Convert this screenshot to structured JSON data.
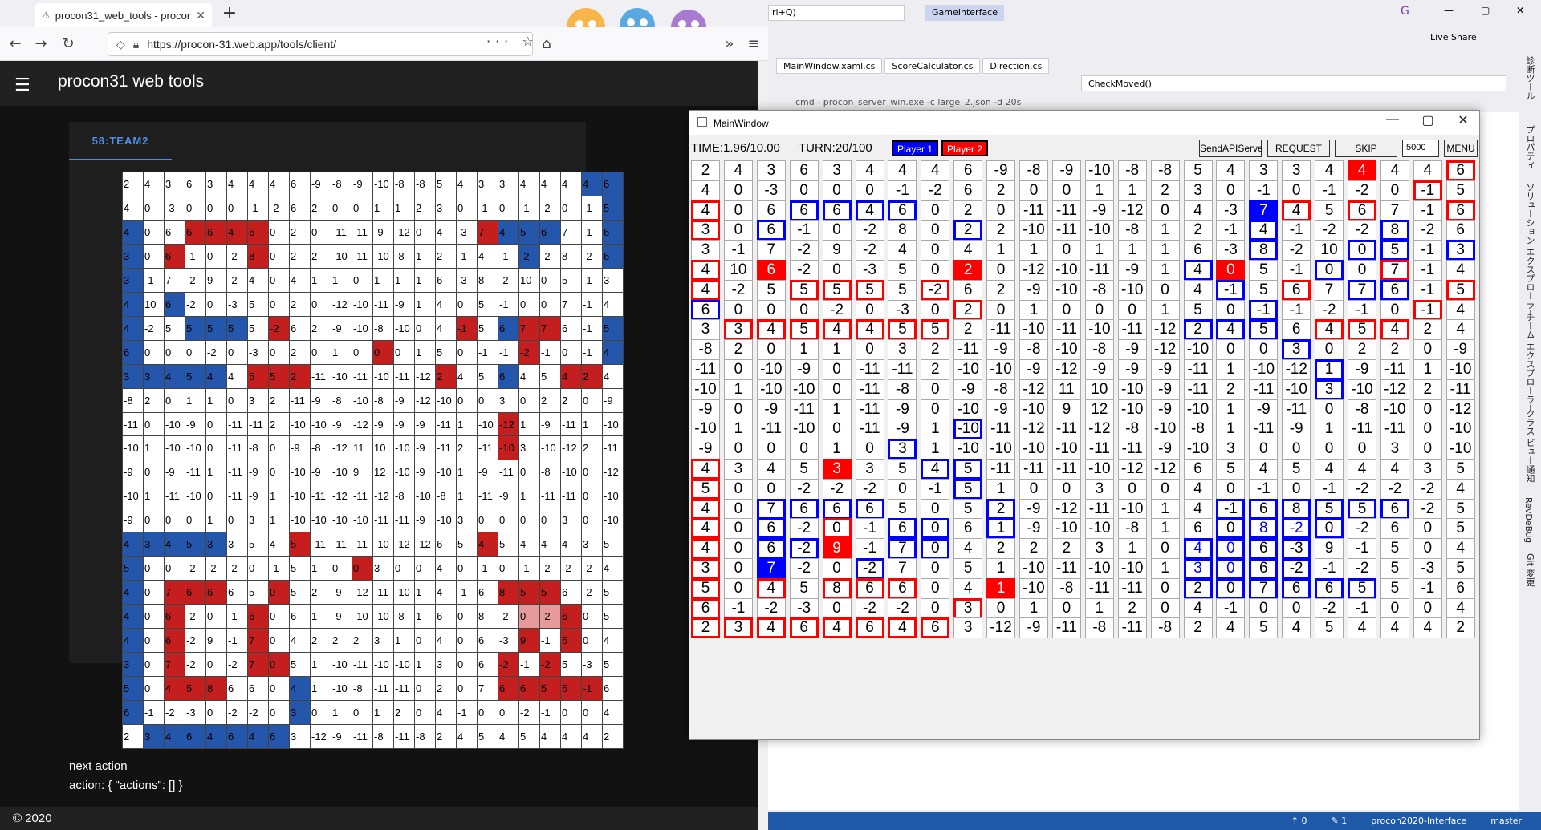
{
  "browser": {
    "tab_title": "procon31_web_tools - procon3",
    "url": "https://procon-31.web.app/tools/client/",
    "app_title": "procon31 web tools",
    "team_tab": "58:TEAM2",
    "next_action_label": "next action",
    "action_text": "action: { \"actions\": [] }",
    "footer": "© 2020"
  },
  "web_grid": [
    [
      "2",
      "4",
      "3",
      "6",
      "3",
      "4",
      "4",
      "4",
      "6",
      "-9",
      "-8",
      "-9",
      "-10",
      "-8",
      "-8",
      "5",
      "4",
      "3",
      "3",
      "4",
      "4",
      "4",
      "4",
      "6"
    ],
    [
      "4",
      "0",
      "-3",
      "0",
      "0",
      "0",
      "-1",
      "-2",
      "6",
      "2",
      "0",
      "0",
      "1",
      "1",
      "2",
      "3",
      "0",
      "-1",
      "0",
      "-1",
      "-2",
      "0",
      "-1",
      "5"
    ],
    [
      "4",
      "0",
      "6",
      "6",
      "6",
      "4",
      "6",
      "0",
      "2",
      "0",
      "-11",
      "-11",
      "-9",
      "-12",
      "0",
      "4",
      "-3",
      "7",
      "4",
      "5",
      "6",
      "7",
      "-1",
      "6"
    ],
    [
      "3",
      "0",
      "6",
      "-1",
      "0",
      "-2",
      "8",
      "0",
      "2",
      "2",
      "-10",
      "-11",
      "-10",
      "-8",
      "1",
      "2",
      "-1",
      "4",
      "-1",
      "-2",
      "-2",
      "8",
      "-2",
      "6"
    ],
    [
      "3",
      "-1",
      "7",
      "-2",
      "9",
      "-2",
      "4",
      "0",
      "4",
      "1",
      "1",
      "0",
      "1",
      "1",
      "1",
      "6",
      "-3",
      "8",
      "-2",
      "10",
      "0",
      "5",
      "-1",
      "3"
    ],
    [
      "4",
      "10",
      "6",
      "-2",
      "0",
      "-3",
      "5",
      "0",
      "2",
      "0",
      "-12",
      "-10",
      "-11",
      "-9",
      "1",
      "4",
      "0",
      "5",
      "-1",
      "0",
      "0",
      "7",
      "-1",
      "4"
    ],
    [
      "4",
      "-2",
      "5",
      "5",
      "5",
      "5",
      "5",
      "-2",
      "6",
      "2",
      "-9",
      "-10",
      "-8",
      "-10",
      "0",
      "4",
      "-1",
      "5",
      "6",
      "7",
      "7",
      "6",
      "-1",
      "5"
    ],
    [
      "6",
      "0",
      "0",
      "0",
      "-2",
      "0",
      "-3",
      "0",
      "2",
      "0",
      "1",
      "0",
      "0",
      "0",
      "1",
      "5",
      "0",
      "-1",
      "-1",
      "-2",
      "-1",
      "0",
      "-1",
      "4"
    ],
    [
      "3",
      "3",
      "4",
      "5",
      "4",
      "4",
      "5",
      "5",
      "2",
      "-11",
      "-10",
      "-11",
      "-10",
      "-11",
      "-12",
      "2",
      "4",
      "5",
      "6",
      "4",
      "5",
      "4",
      "2",
      "4"
    ],
    [
      "-8",
      "2",
      "0",
      "1",
      "1",
      "0",
      "3",
      "2",
      "-11",
      "-9",
      "-8",
      "-10",
      "-8",
      "-9",
      "-12",
      "-10",
      "0",
      "0",
      "3",
      "0",
      "2",
      "2",
      "0",
      "-9"
    ],
    [
      "-11",
      "0",
      "-10",
      "-9",
      "0",
      "-11",
      "-11",
      "2",
      "-10",
      "-10",
      "-9",
      "-12",
      "-9",
      "-9",
      "-9",
      "-11",
      "1",
      "-10",
      "-12",
      "1",
      "-9",
      "-11",
      "1",
      "-10"
    ],
    [
      "-10",
      "1",
      "-10",
      "-10",
      "0",
      "-11",
      "-8",
      "0",
      "-9",
      "-8",
      "-12",
      "11",
      "10",
      "-10",
      "-9",
      "-11",
      "2",
      "-11",
      "-10",
      "3",
      "-10",
      "-12",
      "2",
      "-11"
    ],
    [
      "-9",
      "0",
      "-9",
      "-11",
      "1",
      "-11",
      "-9",
      "0",
      "-10",
      "-9",
      "-10",
      "9",
      "12",
      "-10",
      "-9",
      "-10",
      "1",
      "-9",
      "-11",
      "0",
      "-8",
      "-10",
      "0",
      "-12"
    ],
    [
      "-10",
      "1",
      "-11",
      "-10",
      "0",
      "-11",
      "-9",
      "1",
      "-10",
      "-11",
      "-12",
      "-11",
      "-12",
      "-8",
      "-10",
      "-8",
      "1",
      "-11",
      "-9",
      "1",
      "-11",
      "-11",
      "0",
      "-10"
    ],
    [
      "-9",
      "0",
      "0",
      "0",
      "1",
      "0",
      "3",
      "1",
      "-10",
      "-10",
      "-10",
      "-10",
      "-11",
      "-11",
      "-9",
      "-10",
      "3",
      "0",
      "0",
      "0",
      "0",
      "3",
      "0",
      "-10"
    ],
    [
      "4",
      "3",
      "4",
      "5",
      "3",
      "3",
      "5",
      "4",
      "5",
      "-11",
      "-11",
      "-11",
      "-10",
      "-12",
      "-12",
      "6",
      "5",
      "4",
      "5",
      "4",
      "4",
      "4",
      "3",
      "5"
    ],
    [
      "5",
      "0",
      "0",
      "-2",
      "-2",
      "-2",
      "0",
      "-1",
      "5",
      "1",
      "0",
      "0",
      "3",
      "0",
      "0",
      "4",
      "0",
      "-1",
      "0",
      "-1",
      "-2",
      "-2",
      "-2",
      "4"
    ],
    [
      "4",
      "0",
      "7",
      "6",
      "6",
      "6",
      "5",
      "0",
      "5",
      "2",
      "-9",
      "-12",
      "-11",
      "-10",
      "1",
      "4",
      "-1",
      "6",
      "8",
      "5",
      "5",
      "6",
      "-2",
      "5"
    ],
    [
      "4",
      "0",
      "6",
      "-2",
      "0",
      "-1",
      "6",
      "0",
      "6",
      "1",
      "-9",
      "-10",
      "-10",
      "-8",
      "1",
      "6",
      "0",
      "8",
      "-2",
      "0",
      "-2",
      "6",
      "0",
      "5"
    ],
    [
      "4",
      "0",
      "6",
      "-2",
      "9",
      "-1",
      "7",
      "0",
      "4",
      "2",
      "2",
      "2",
      "3",
      "1",
      "0",
      "4",
      "0",
      "6",
      "-3",
      "9",
      "-1",
      "5",
      "0",
      "4"
    ],
    [
      "3",
      "0",
      "7",
      "-2",
      "0",
      "-2",
      "7",
      "0",
      "5",
      "1",
      "-10",
      "-11",
      "-10",
      "-10",
      "1",
      "3",
      "0",
      "6",
      "-2",
      "-1",
      "-2",
      "5",
      "-3",
      "5"
    ],
    [
      "5",
      "0",
      "4",
      "5",
      "8",
      "6",
      "6",
      "0",
      "4",
      "1",
      "-10",
      "-8",
      "-11",
      "-11",
      "0",
      "2",
      "0",
      "7",
      "6",
      "6",
      "5",
      "5",
      "-1",
      "6"
    ],
    [
      "6",
      "-1",
      "-2",
      "-3",
      "0",
      "-2",
      "-2",
      "0",
      "3",
      "0",
      "1",
      "0",
      "1",
      "2",
      "0",
      "4",
      "-1",
      "0",
      "0",
      "-2",
      "-1",
      "0",
      "0",
      "4"
    ],
    [
      "2",
      "3",
      "4",
      "6",
      "4",
      "6",
      "4",
      "6",
      "3",
      "-12",
      "-9",
      "-11",
      "-8",
      "-11",
      "-8",
      "2",
      "4",
      "5",
      "4",
      "5",
      "4",
      "4",
      "4",
      "2"
    ]
  ],
  "web_grid_colors": [
    "......................bb",
    ".......................b",
    "b..rrrr..........rbbb..b",
    "b.r...r............b...b",
    "b.......................",
    "b.b.......................",
    "b..bbb.r........r.brr..b",
    "b...........r......r...b",
    "bbbbb.rrr......r..b..rr.",
    "........................",
    "..................r.....",
    "..................r.....",
    "..........................",
    "..........................",
    "..........................",
    "bbbbb...r........r......",
    "b..........r............",
    "b.rrr..r..........rrr...",
    "b.r...r............ppr..",
    "b.r...r............r.r..",
    "b.r...rr..........r.r...",
    "b.rrr...b.........rrrrr.",
    "b.......b...............",
    ".bbbbbbb................"
  ],
  "mainwindow": {
    "title": "MainWindow",
    "time": "TIME:1.96/10.00",
    "turn": "TURN:20/100",
    "player1": "Player 1",
    "player2": "Player 2",
    "btn_send": "SendAPIServe",
    "btn_request": "REQUEST",
    "btn_skip": "SKIP",
    "input_value": "5000",
    "btn_menu": "MENU"
  },
  "wpf_grid_styles": [
    "....................ra..rr",
    "......................r.",
    "r..bbbb..........bar.r..r",
    "r.b.....b........b...b..r",
    ".................b..bb.b..",
    "r.ra.....ra......bra..b.r",
    "r..rrr.r........b.r.bb.r",
    "b.......r........b....r.r",
    ".rrrrrrr.......bbb.rrr.",
    "..................b.....",
    "...................b....",
    "...................b....",
    "........................",
    "........b...............",
    "......b.................",
    "r...ra..bb..............",
    "r.......b...............",
    "r.bbbb...b......bbbbbb..",
    "r.b.r.bb.b......bbtbtb..",
    "r.bbra.bb.......btbtbb..",
    "r.ba..b.........btbtbb..",
    "r.r.rrr..ra.....bbbbbb..",
    "r.......r...............",
    "rrrrrrrr................"
  ],
  "vs": {
    "search_hint": "rl+Q)",
    "solution": "GameInterface",
    "live_share": "Live Share",
    "tabs": [
      "MainWindow.xaml.cs",
      "ScoreCalculator.cs",
      "Direction.cs"
    ],
    "crumb": "CheckMoved()",
    "cmd": "cmd - procon_server_win.exe  -c large_2.json -d 20s",
    "side_items": [
      "診断ツール",
      "プロパティ",
      "ソリューション エクスプローラー",
      "チーム エクスプローラー",
      "クラス ビュー",
      "通知",
      "RevDeBug",
      "Git 変更"
    ],
    "status": {
      "errors": "0",
      "changes": "1",
      "project": "procon2020-Interface",
      "branch": "master"
    }
  }
}
